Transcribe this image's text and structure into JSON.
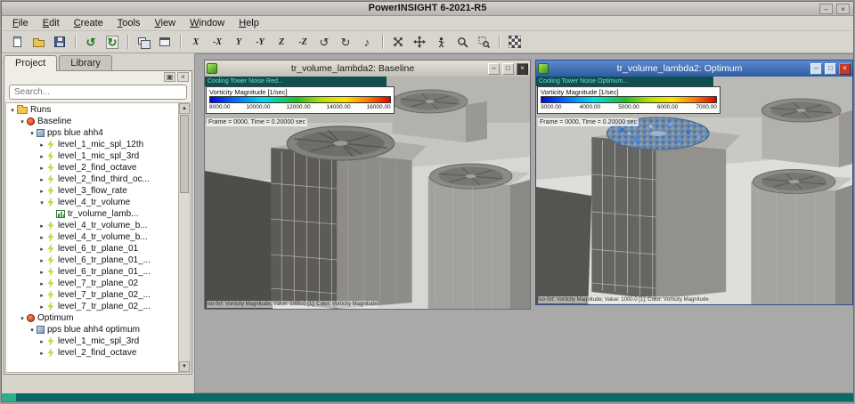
{
  "app": {
    "title": "PowerINSIGHT 6-2021-R5"
  },
  "chrome": {
    "minimize_glyph": "–",
    "maximize_glyph": "□",
    "close_glyph": "×"
  },
  "menu": {
    "items": [
      "File",
      "Edit",
      "Create",
      "Tools",
      "View",
      "Window",
      "Help"
    ]
  },
  "toolbar": {
    "buttons": [
      {
        "name": "import-icon"
      },
      {
        "name": "open-icon"
      },
      {
        "name": "save-icon"
      },
      {
        "separator": true
      },
      {
        "name": "refresh-icon"
      },
      {
        "name": "run-icon"
      },
      {
        "separator": true
      },
      {
        "name": "tile-windows-icon"
      },
      {
        "name": "cascade-windows-icon"
      },
      {
        "separator": true
      },
      {
        "name": "view-x-icon",
        "label": "X"
      },
      {
        "name": "view-neg-x-icon",
        "label": "-X"
      },
      {
        "name": "view-y-icon",
        "label": "Y"
      },
      {
        "name": "view-neg-y-icon",
        "label": "-Y"
      },
      {
        "name": "view-z-icon",
        "label": "Z"
      },
      {
        "name": "view-neg-z-icon",
        "label": "-Z"
      },
      {
        "name": "rotate-ccw-icon"
      },
      {
        "name": "rotate-cw-icon"
      },
      {
        "name": "animation-icon"
      },
      {
        "separator": true
      },
      {
        "name": "fit-view-icon"
      },
      {
        "name": "pan-icon"
      },
      {
        "name": "walkthrough-icon"
      },
      {
        "name": "zoom-icon"
      },
      {
        "name": "zoom-region-icon"
      },
      {
        "separator": true
      },
      {
        "name": "render-icon"
      }
    ]
  },
  "dock": {
    "tabs": [
      "Project",
      "Library"
    ],
    "search_placeholder": "Search...",
    "tree": [
      {
        "depth": 0,
        "arrow": "expanded",
        "icon": "folder",
        "label": "Runs"
      },
      {
        "depth": 1,
        "arrow": "expanded",
        "icon": "run",
        "label": "Baseline"
      },
      {
        "depth": 2,
        "arrow": "expanded",
        "icon": "case",
        "label": "pps blue ahh4"
      },
      {
        "depth": 3,
        "arrow": "collapsed",
        "icon": "analysis",
        "label": "level_1_mic_spl_12th"
      },
      {
        "depth": 3,
        "arrow": "collapsed",
        "icon": "analysis",
        "label": "level_1_mic_spl_3rd"
      },
      {
        "depth": 3,
        "arrow": "collapsed",
        "icon": "analysis",
        "label": "level_2_find_octave"
      },
      {
        "depth": 3,
        "arrow": "collapsed",
        "icon": "analysis",
        "label": "level_2_find_third_oc..."
      },
      {
        "depth": 3,
        "arrow": "collapsed",
        "icon": "analysis",
        "label": "level_3_flow_rate"
      },
      {
        "depth": 3,
        "arrow": "expanded",
        "icon": "analysis",
        "label": "level_4_tr_volume"
      },
      {
        "depth": 4,
        "arrow": "none",
        "icon": "chart",
        "label": "tr_volume_lamb..."
      },
      {
        "depth": 3,
        "arrow": "collapsed",
        "icon": "analysis",
        "label": "level_4_tr_volume_b..."
      },
      {
        "depth": 3,
        "arrow": "collapsed",
        "icon": "analysis",
        "label": "level_4_tr_volume_b..."
      },
      {
        "depth": 3,
        "arrow": "collapsed",
        "icon": "analysis",
        "label": "level_6_tr_plane_01"
      },
      {
        "depth": 3,
        "arrow": "collapsed",
        "icon": "analysis",
        "label": "level_6_tr_plane_01_..."
      },
      {
        "depth": 3,
        "arrow": "collapsed",
        "icon": "analysis",
        "label": "level_6_tr_plane_01_..."
      },
      {
        "depth": 3,
        "arrow": "collapsed",
        "icon": "analysis",
        "label": "level_7_tr_plane_02"
      },
      {
        "depth": 3,
        "arrow": "collapsed",
        "icon": "analysis",
        "label": "level_7_tr_plane_02_..."
      },
      {
        "depth": 3,
        "arrow": "collapsed",
        "icon": "analysis",
        "label": "level_7_tr_plane_02_..."
      },
      {
        "depth": 1,
        "arrow": "expanded",
        "icon": "run",
        "label": "Optimum"
      },
      {
        "depth": 2,
        "arrow": "expanded",
        "icon": "case",
        "label": "pps blue ahh4 optimum"
      },
      {
        "depth": 3,
        "arrow": "collapsed",
        "icon": "analysis",
        "label": "level_1_mic_spl_3rd"
      },
      {
        "depth": 3,
        "arrow": "collapsed",
        "icon": "analysis",
        "label": "level_2_find_octave"
      }
    ]
  },
  "windows": [
    {
      "title": "tr_volume_lambda2: Baseline",
      "overlay_header": "Cooling Tower Noise Red...",
      "legend_title": "Vorticity Magnitude [1/sec]",
      "ticks": [
        "8000.00",
        "10000.00",
        "12000.00",
        "14000.00",
        "16000.00"
      ],
      "frame_text": "Frame = 0000, Time = 0.20000 sec",
      "footer_text": "Iso-Srf: Vorticity Magnitude; Value: 1000.0 [1]; Color: Vorticity Magnitude"
    },
    {
      "title": "tr_volume_lambda2: Optimum",
      "overlay_header": "Cooling Tower Noise Optimum...",
      "legend_title": "Vorticity Magnitude [1/sec]",
      "ticks": [
        "3000.00",
        "4000.00",
        "5000.00",
        "6000.00",
        "7000.00"
      ],
      "frame_text": "Frame = 0000, Time = 0.20000 sec",
      "footer_text": "Iso-Srf: Vorticity Magnitude; Value: 1000.0 [1]; Color: Vorticity Magnitude"
    }
  ],
  "colors": {
    "active_child_titlebar": "#3f6cb0",
    "status_teal": "#0b6a66",
    "legend_low": "#0008d8",
    "legend_high": "#e00000"
  }
}
